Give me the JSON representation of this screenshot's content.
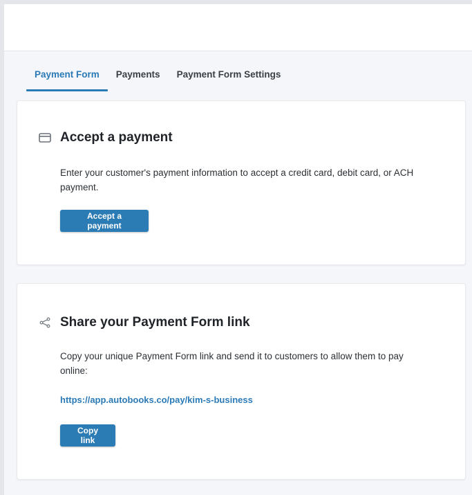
{
  "tabs": [
    {
      "label": "Payment Form",
      "active": true
    },
    {
      "label": "Payments",
      "active": false
    },
    {
      "label": "Payment Form Settings",
      "active": false
    }
  ],
  "accept_card": {
    "icon": "credit-card-icon",
    "title": "Accept a payment",
    "description": "Enter your customer's payment information to accept a credit card, debit card, or ACH payment.",
    "button_label": "Accept a payment"
  },
  "share_card": {
    "icon": "share-icon",
    "title": "Share your Payment Form link",
    "description": "Copy your unique Payment Form link and send it to customers to allow them to pay online:",
    "link": "https://app.autobooks.co/pay/kim-s-business",
    "button_label": "Copy link"
  },
  "colors": {
    "accent": "#2a7ab8",
    "button": "#2b7bb5",
    "page_bg": "#f4f6f9"
  }
}
